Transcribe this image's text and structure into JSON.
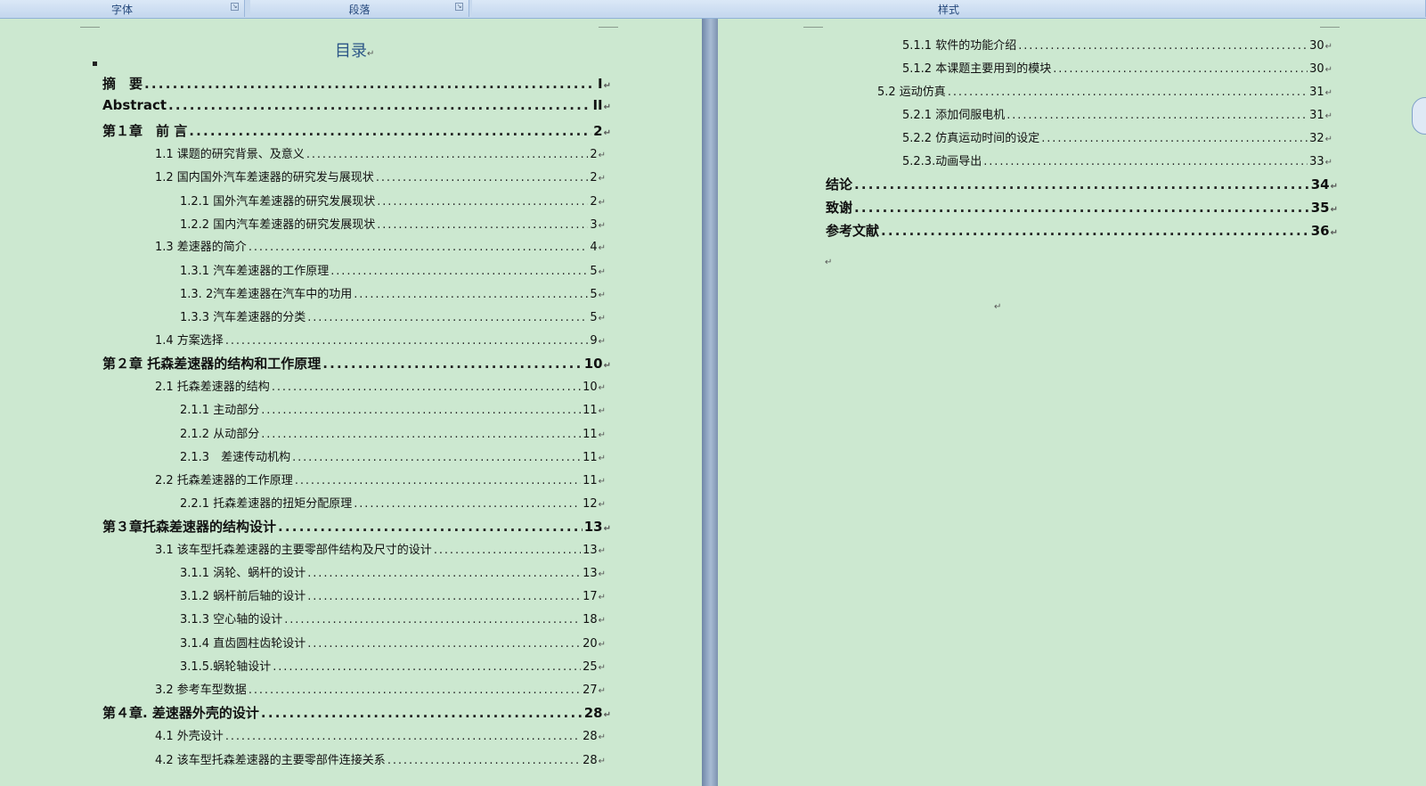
{
  "ribbon": {
    "groups": [
      {
        "label": "字体"
      },
      {
        "label": "段落"
      },
      {
        "label": "样式"
      }
    ]
  },
  "left_page": {
    "title": "目录",
    "entries": [
      {
        "level": 1,
        "text": "摘　要",
        "page": "I"
      },
      {
        "level": 1,
        "text": "Abstract",
        "page": "II"
      },
      {
        "level": 1,
        "text": "第１章　前 言",
        "page": "2"
      },
      {
        "level": 2,
        "text": "1.1 课题的研究背景、及意义",
        "page": "2"
      },
      {
        "level": 2,
        "text": "1.2 国内国外汽车差速器的研究发与展现状",
        "page": "2"
      },
      {
        "level": 3,
        "text": "1.2.1 国外汽车差速器的研究发展现状",
        "page": "2"
      },
      {
        "level": 3,
        "text": "1.2.2 国内汽车差速器的研究发展现状",
        "page": "3"
      },
      {
        "level": 2,
        "text": "1.3 差速器的简介",
        "page": "4"
      },
      {
        "level": 3,
        "text": "1.3.1 汽车差速器的工作原理",
        "page": "5"
      },
      {
        "level": 3,
        "text": "1.3. 2汽车差速器在汽车中的功用",
        "page": "5"
      },
      {
        "level": 3,
        "text": "1.3.3 汽车差速器的分类",
        "page": "5"
      },
      {
        "level": 2,
        "text": "1.4 方案选择",
        "page": "9"
      },
      {
        "level": 1,
        "text": "第２章 托森差速器的结构和工作原理",
        "page": "10"
      },
      {
        "level": 2,
        "text": "2.1 托森差速器的结构",
        "page": "10"
      },
      {
        "level": 3,
        "text": "2.1.1 主动部分",
        "page": "11"
      },
      {
        "level": 3,
        "text": "2.1.2 从动部分",
        "page": "11"
      },
      {
        "level": 3,
        "text": "2.1.3　差速传动机构",
        "page": "11"
      },
      {
        "level": 2,
        "text": "2.2 托森差速器的工作原理",
        "page": "11"
      },
      {
        "level": 3,
        "text": "2.2.1 托森差速器的扭矩分配原理",
        "page": "12"
      },
      {
        "level": 1,
        "text": "第３章托森差速器的结构设计",
        "page": "13"
      },
      {
        "level": 2,
        "text": "3.1 该车型托森差速器的主要零部件结构及尺寸的设计",
        "page": "13"
      },
      {
        "level": 3,
        "text": "3.1.1 涡轮、蜗杆的设计",
        "page": "13"
      },
      {
        "level": 3,
        "text": "3.1.2 蜗杆前后轴的设计",
        "page": "17"
      },
      {
        "level": 3,
        "text": "3.1.3 空心轴的设计",
        "page": "18"
      },
      {
        "level": 3,
        "text": "3.1.4 直齿圆柱齿轮设计",
        "page": "20"
      },
      {
        "level": 3,
        "text": "3.1.5.蜗轮轴设计",
        "page": "25"
      },
      {
        "level": 2,
        "text": "3.2 参考车型数据",
        "page": "27"
      },
      {
        "level": 1,
        "text": "第４章. 差速器外壳的设计",
        "page": "28"
      },
      {
        "level": 2,
        "text": "4.1 外壳设计",
        "page": "28"
      },
      {
        "level": 2,
        "text": "4.2 该车型托森差速器的主要零部件连接关系",
        "page": "28"
      }
    ]
  },
  "right_page": {
    "entries": [
      {
        "level": 3,
        "text": "5.1.1 软件的功能介绍",
        "page": "30"
      },
      {
        "level": 3,
        "text": "5.1.2 本课题主要用到的模块",
        "page": "30"
      },
      {
        "level": 2,
        "text": "5.2 运动仿真",
        "page": "31"
      },
      {
        "level": 3,
        "text": "5.2.1 添加伺服电机",
        "page": "31"
      },
      {
        "level": 3,
        "text": "5.2.2 仿真运动时间的设定",
        "page": "32"
      },
      {
        "level": 3,
        "text": "5.2.3.动画导出",
        "page": "33"
      },
      {
        "level": 1,
        "text": "结论",
        "page": "34"
      },
      {
        "level": 1,
        "text": "致谢",
        "page": "35"
      },
      {
        "level": 1,
        "text": "参考文献",
        "page": "36"
      }
    ]
  },
  "paragraph_mark": "↵",
  "launcher_glyph": "↘",
  "colors": {
    "page_bg": "#cce8d0",
    "title": "#2c5687",
    "ribbon": "#c7d9ee"
  }
}
